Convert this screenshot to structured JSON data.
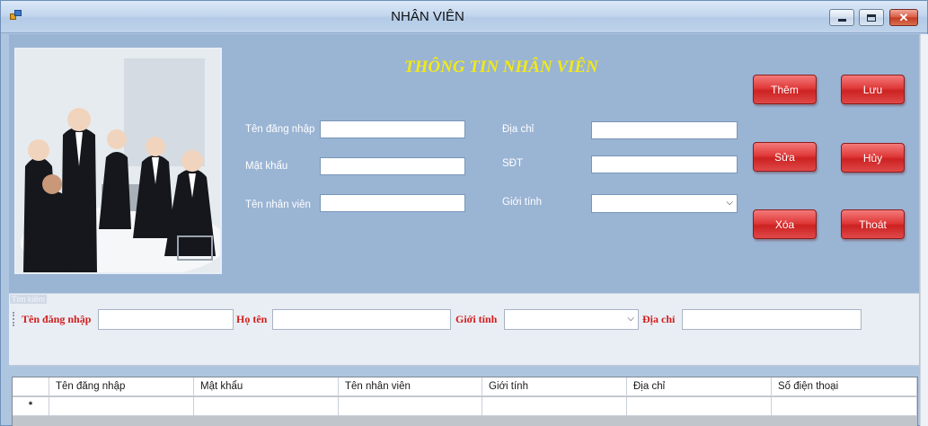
{
  "window": {
    "title": "NHÂN VIÊN",
    "controls": {
      "minimize": "minimize-icon",
      "maximize": "maximize-icon",
      "close": "close-icon",
      "close_glyph": "✕"
    }
  },
  "form": {
    "heading": "THÔNG TIN NHÂN VIÊN",
    "fields": {
      "username": {
        "label": "Tên đăng nhập",
        "value": ""
      },
      "password": {
        "label": "Mật khẩu",
        "value": ""
      },
      "employee_name": {
        "label": "Tên nhân viên",
        "value": ""
      },
      "address": {
        "label": "Địa chỉ",
        "value": ""
      },
      "phone": {
        "label": "SĐT",
        "value": ""
      },
      "gender": {
        "label": "Giới tính",
        "selected": ""
      }
    },
    "buttons": {
      "add": "Thêm",
      "save": "Lưu",
      "edit": "Sửa",
      "cancel": "Hủy",
      "delete": "Xóa",
      "exit": "Thoát"
    },
    "button_color": "#e03a3a",
    "heading_color": "#f2ea14"
  },
  "search": {
    "caption": "Tìm kiếm",
    "username_label": "Tên đăng nhập",
    "fullname_label": "Họ tên",
    "gender_label": "Giới tính",
    "address_label": "Địa chỉ",
    "label_color": "#d11d1d"
  },
  "grid": {
    "columns": [
      "Tên đăng nhập",
      "Mật khẩu",
      "Tên nhân viên",
      "Giới tính",
      "Địa chỉ",
      "Số điện thoại"
    ],
    "new_row_marker": "*"
  },
  "icons": {
    "dropdown": "chevron-down-icon",
    "app": "app-icon"
  }
}
